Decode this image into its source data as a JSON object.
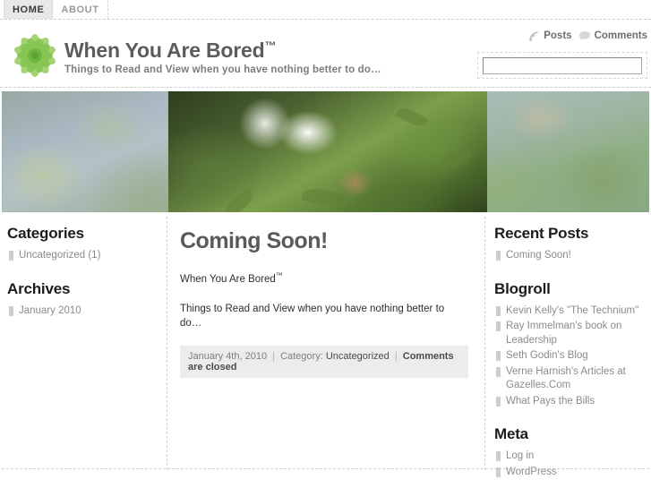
{
  "nav": {
    "tabs": [
      {
        "label": "HOME",
        "active": true
      },
      {
        "label": "ABOUT",
        "active": false
      }
    ]
  },
  "header": {
    "logo_icon": "green-flower-rosette-logo",
    "title": "When You Are Bored",
    "title_tm": "™",
    "tagline": "Things to Read and View when you have nothing better to do…",
    "feeds": [
      {
        "icon": "rss-icon",
        "label": "Posts"
      },
      {
        "icon": "comment-bubble-icon",
        "label": "Comments"
      }
    ],
    "search": {
      "value": "",
      "placeholder": ""
    }
  },
  "banner": {
    "alt": "blurred photo of white wild rose flowers among green foliage"
  },
  "sidebar_left": {
    "widgets": [
      {
        "title": "Categories",
        "items": [
          "Uncategorized (1)"
        ]
      },
      {
        "title": "Archives",
        "items": [
          "January 2010"
        ]
      }
    ]
  },
  "main": {
    "post_title": "Coming Soon!",
    "paragraphs": [
      {
        "text": "When You Are Bored",
        "tm": "™"
      },
      {
        "text": "Things to Read and View when you have nothing better to do…",
        "tm": ""
      }
    ],
    "meta": {
      "date": "January 4th, 2010",
      "sep1": "|",
      "category_label": "Category:",
      "category": "Uncategorized",
      "sep2": "|",
      "comments": "Comments are closed"
    }
  },
  "sidebar_right": {
    "widgets": [
      {
        "title": "Recent Posts",
        "items": [
          "Coming Soon!"
        ]
      },
      {
        "title": "Blogroll",
        "items": [
          "Kevin Kelly's \"The Technium\"",
          "Ray Immelman's book on Leadership",
          "Seth Godin's Blog",
          "Verne Harnish's Articles at Gazelles.Com",
          "What Pays the Bills"
        ]
      },
      {
        "title": "Meta",
        "items": [
          "Log in",
          "WordPress"
        ]
      }
    ]
  },
  "colors": {
    "page_bg": "#ffffff",
    "nav_active_bg": "#e8e8e8",
    "heading": "#1c1c1c",
    "title_gray": "#5c5c5c",
    "muted": "#8b8b8b",
    "meta_bg": "#ececec",
    "dashed_border": "#cfcfcf",
    "logo_green": "#7bbf4a"
  }
}
